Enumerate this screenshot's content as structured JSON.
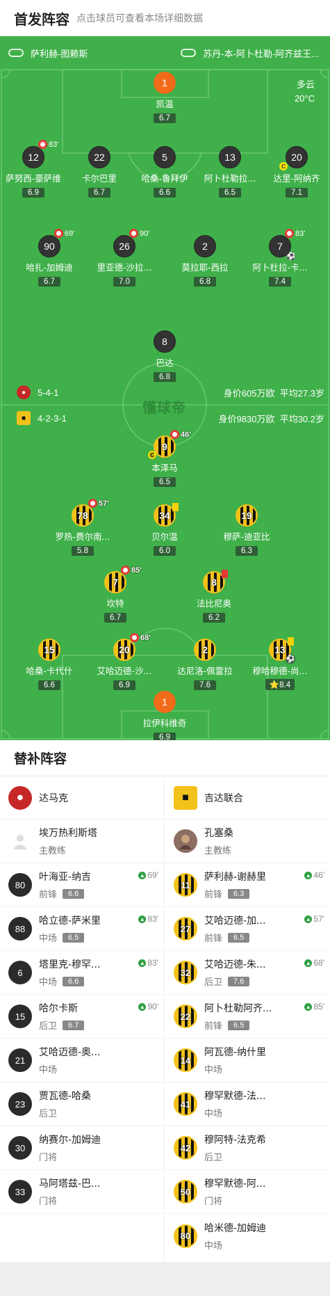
{
  "header": {
    "title": "首发阵容",
    "subtitle": "点击球员可查看本场详细数据"
  },
  "coaches": {
    "home": "萨利赫-图赖斯",
    "away": "苏丹-本-阿卜杜勒-阿齐兹王..."
  },
  "weather": {
    "condition": "多云",
    "temp": "20°C"
  },
  "home": {
    "formation": "5-4-1",
    "info": "身价605万欧",
    "age": "平均27.3岁"
  },
  "away": {
    "formation": "4-2-3-1",
    "info": "身价9830万欧",
    "age": "平均30.2岁"
  },
  "brand": "懂球帝",
  "home_players": [
    {
      "num": "1",
      "name": "凯温",
      "rating": "6.7"
    },
    {
      "num": "12",
      "name": "萨努西-豪萨维",
      "rating": "6.9",
      "sub": "83'"
    },
    {
      "num": "22",
      "name": "卡尔巴里",
      "rating": "6.7"
    },
    {
      "num": "5",
      "name": "哈桑-鲁拜伊",
      "rating": "6.6"
    },
    {
      "num": "13",
      "name": "阿卜杜勒拉...",
      "rating": "6.5"
    },
    {
      "num": "20",
      "name": "达里-阿纳齐",
      "rating": "7.1",
      "cap": "C"
    },
    {
      "num": "90",
      "name": "哈扎-加姆迪",
      "rating": "6.7",
      "sub": "69'"
    },
    {
      "num": "26",
      "name": "里亚德-沙拉...",
      "rating": "7.0",
      "sub": "90'"
    },
    {
      "num": "2",
      "name": "莫拉耶-西拉",
      "rating": "6.8"
    },
    {
      "num": "7",
      "name": "阿卜杜拉-卡...",
      "rating": "7.4",
      "sub": "83'"
    },
    {
      "num": "8",
      "name": "巴达",
      "rating": "6.8"
    }
  ],
  "away_players": [
    {
      "num": "9",
      "name": "本泽马",
      "rating": "6.5",
      "sub": "46'",
      "cap": "C"
    },
    {
      "num": "78",
      "name": "罗热-费尔南...",
      "rating": "5.8",
      "sub": "57'"
    },
    {
      "num": "34",
      "name": "贝尔温",
      "rating": "6.0"
    },
    {
      "num": "19",
      "name": "穆萨-迪亚比",
      "rating": "6.3"
    },
    {
      "num": "7",
      "name": "坎特",
      "rating": "6.7",
      "sub": "85'"
    },
    {
      "num": "8",
      "name": "法比尼奥",
      "rating": "6.2"
    },
    {
      "num": "15",
      "name": "哈桑-卡代什",
      "rating": "6.6"
    },
    {
      "num": "20",
      "name": "艾哈迈德-沙...",
      "rating": "6.9",
      "sub": "68'"
    },
    {
      "num": "2",
      "name": "达尼洛-佩雷拉",
      "rating": "7.6"
    },
    {
      "num": "13",
      "name": "穆哈穆德-尚...",
      "rating": "8.4"
    },
    {
      "num": "1",
      "name": "拉伊科维奇",
      "rating": "6.9"
    }
  ],
  "subs": {
    "title": "替补阵容",
    "home_team": "达马克",
    "away_team": "吉达联合",
    "home_manager": {
      "name": "埃万热利斯塔",
      "role": "主教练"
    },
    "away_manager": {
      "name": "孔塞桑",
      "role": "主教练"
    },
    "home": [
      {
        "num": "80",
        "name": "叶海亚-纳吉",
        "pos": "前锋",
        "rating": "6.6",
        "time": "69'"
      },
      {
        "num": "88",
        "name": "哈立德-萨米里",
        "pos": "中场",
        "rating": "6.5",
        "time": "83'"
      },
      {
        "num": "6",
        "name": "塔里克-穆罕...",
        "pos": "中场",
        "rating": "6.6",
        "time": "83'"
      },
      {
        "num": "15",
        "name": "哈尔卡斯",
        "pos": "后卫",
        "rating": "6.7",
        "time": "90'"
      },
      {
        "num": "21",
        "name": "艾哈迈德-奥...",
        "pos": "中场"
      },
      {
        "num": "23",
        "name": "贾瓦德-哈桑",
        "pos": "后卫"
      },
      {
        "num": "30",
        "name": "纳赛尔-加姆迪",
        "pos": "门将"
      },
      {
        "num": "33",
        "name": "马阿塔兹-巴...",
        "pos": "门将"
      }
    ],
    "away": [
      {
        "num": "11",
        "name": "萨利赫-谢赫里",
        "pos": "前锋",
        "rating": "6.3",
        "time": "46'"
      },
      {
        "num": "27",
        "name": "艾哈迈德-加...",
        "pos": "前锋",
        "rating": "6.5",
        "time": "57'"
      },
      {
        "num": "32",
        "name": "艾哈迈德-朱...",
        "pos": "后卫",
        "rating": "7.6",
        "time": "68'"
      },
      {
        "num": "22",
        "name": "阿卜杜勒阿齐...",
        "pos": "前锋",
        "rating": "6.5",
        "time": "85'"
      },
      {
        "num": "14",
        "name": "阿瓦德-纳什里",
        "pos": "中场"
      },
      {
        "num": "41",
        "name": "穆罕默德-法...",
        "pos": "中场"
      },
      {
        "num": "42",
        "name": "穆阿特-法克希",
        "pos": "后卫"
      },
      {
        "num": "50",
        "name": "穆罕默德-阿...",
        "pos": "门将"
      },
      {
        "num": "80",
        "name": "哈米德-加姆迪",
        "pos": "中场"
      }
    ]
  }
}
